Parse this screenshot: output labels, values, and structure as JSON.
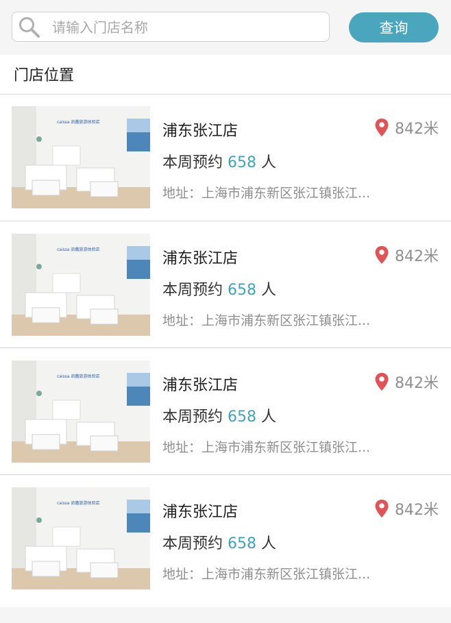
{
  "search": {
    "placeholder": "请输入门店名称",
    "button_label": "查询"
  },
  "section": {
    "title": "门店位置"
  },
  "stores": [
    {
      "name": "浦东张江店",
      "distance": "842米",
      "booking_prefix": "本周预约",
      "booking_count": "658",
      "booking_unit": "人",
      "address": "地址：上海市浦东新区张江镇张江...",
      "brand_sign": "caissa 凯撒旅游体验店"
    },
    {
      "name": "浦东张江店",
      "distance": "842米",
      "booking_prefix": "本周预约",
      "booking_count": "658",
      "booking_unit": "人",
      "address": "地址：上海市浦东新区张江镇张江...",
      "brand_sign": "caissa 凯撒旅游体验店"
    },
    {
      "name": "浦东张江店",
      "distance": "842米",
      "booking_prefix": "本周预约",
      "booking_count": "658",
      "booking_unit": "人",
      "address": "地址：上海市浦东新区张江镇张江...",
      "brand_sign": "caissa 凯撒旅游体验店"
    },
    {
      "name": "浦东张江店",
      "distance": "842米",
      "booking_prefix": "本周预约",
      "booking_count": "658",
      "booking_unit": "人",
      "address": "地址：上海市浦东新区张江镇张江...",
      "brand_sign": "caissa 凯撒旅游体验店"
    }
  ],
  "colors": {
    "accent": "#4aa6bd",
    "booking_number": "#3fa4bb",
    "pin": "#e05356"
  },
  "icons": {
    "search": "search-icon",
    "location": "location-pin-icon"
  }
}
